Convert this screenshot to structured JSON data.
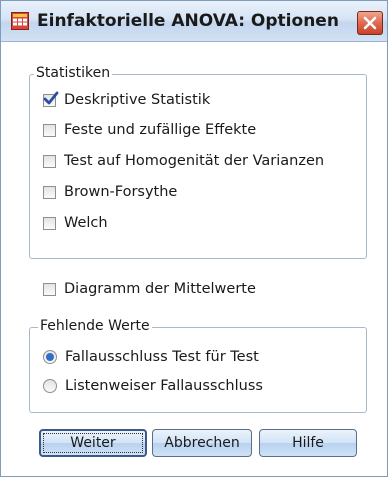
{
  "dialog": {
    "title": "Einfaktorielle ANOVA: Optionen"
  },
  "statistiken": {
    "legend": "Statistiken",
    "items": [
      {
        "label": "Deskriptive Statistik",
        "checked": true
      },
      {
        "label": "Feste und zufällige Effekte",
        "checked": false
      },
      {
        "label": "Test auf Homogenität der Varianzen",
        "checked": false
      },
      {
        "label": "Brown-Forsythe",
        "checked": false
      },
      {
        "label": "Welch",
        "checked": false
      }
    ]
  },
  "mittelwerte": {
    "label": "Diagramm der Mittelwerte",
    "checked": false
  },
  "fehlende_werte": {
    "legend": "Fehlende Werte",
    "options": [
      {
        "label": "Fallausschluss Test für Test",
        "selected": true
      },
      {
        "label": "Listenweiser Fallausschluss",
        "selected": false
      }
    ]
  },
  "buttons": {
    "weiter": "Weiter",
    "abbrechen": "Abbrechen",
    "hilfe": "Hilfe"
  },
  "colors": {
    "accent": "#2f6ec9",
    "close": "#d9553a"
  }
}
